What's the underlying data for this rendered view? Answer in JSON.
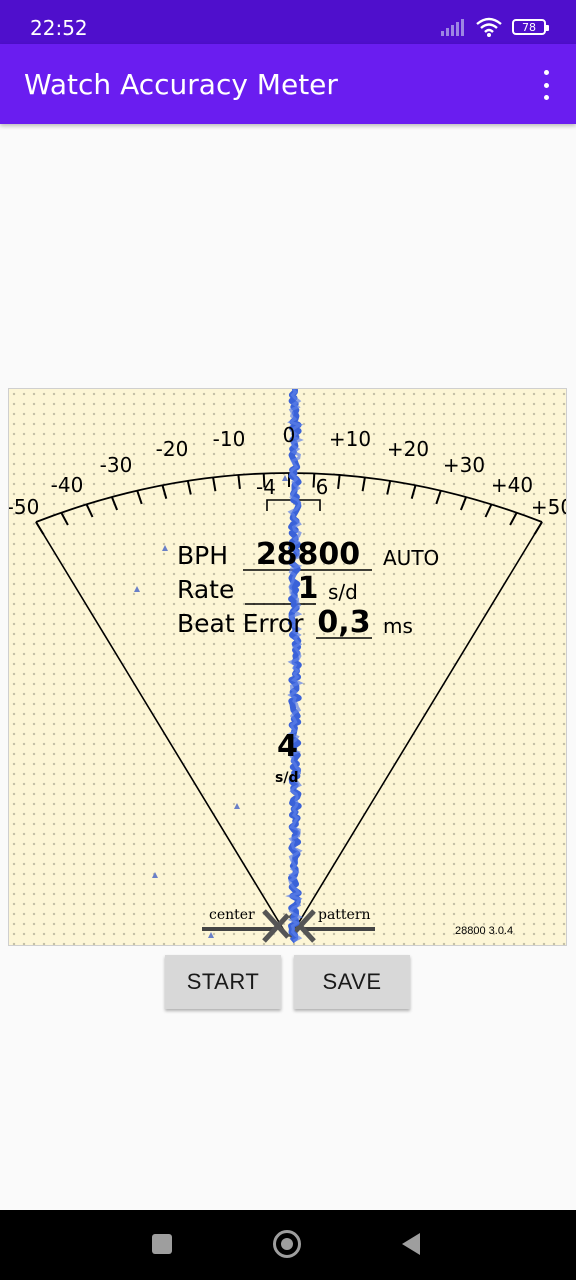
{
  "status_bar": {
    "time": "22:52",
    "battery": "78"
  },
  "app_bar": {
    "title": "Watch Accuracy Meter",
    "menu_icon": "more-vert-icon"
  },
  "meter": {
    "scale_labels": {
      "m50": "-50",
      "m40": "-40",
      "m30": "-30",
      "m20": "-20",
      "m10": "-10",
      "zero": "0",
      "p10": "+10",
      "p20": "+20",
      "p30": "+30",
      "p40": "+40",
      "p50": "+50",
      "reading_left": "-4",
      "reading_right": "6"
    },
    "bph": {
      "label": "BPH",
      "value": "28800",
      "mode": "AUTO"
    },
    "rate": {
      "label": "Rate",
      "value": "1",
      "unit": "s/d"
    },
    "beat_error": {
      "label": "Beat Error",
      "value": "0,3",
      "unit": "ms"
    },
    "needle_value": "4",
    "needle_unit": "s/d",
    "center_label": "center",
    "pattern_label": "pattern",
    "version": "28800 3.0.4",
    "colors": {
      "background": "#fdf6d6",
      "trace": "#3a62d8"
    }
  },
  "buttons": {
    "start": "START",
    "save": "SAVE"
  },
  "nav": {
    "icons": [
      "recents-icon",
      "home-icon",
      "back-icon"
    ]
  }
}
